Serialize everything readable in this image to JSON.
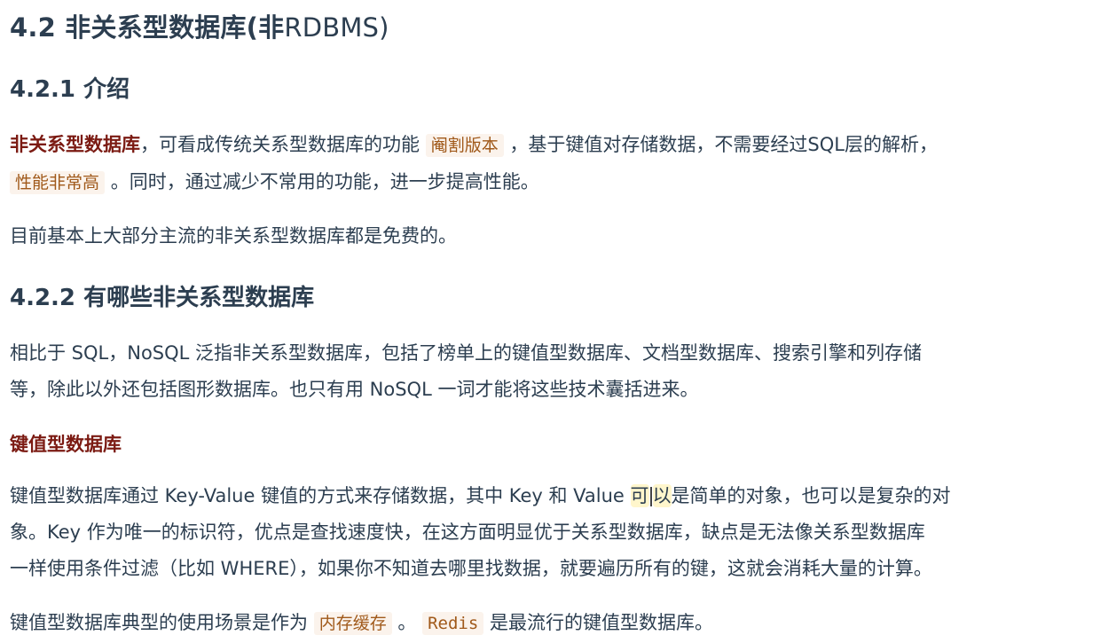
{
  "section": {
    "title_num": "4.2",
    "title_text": "非关系型数据库(非",
    "title_latin": "RDBMS)"
  },
  "intro": {
    "heading": "4.2.1 介绍",
    "p1": {
      "bold": "非关系型数据库",
      "t1": "，可看成传统关系型数据库的功能",
      "code1": "阉割版本",
      "t2": "，基于键值对存储数据，不需要经过SQL层的解析，",
      "code2": "性能非常高",
      "t3": "。同时，通过减少不常用的功能，进一步提高性能。"
    },
    "p2": "目前基本上大部分主流的非关系型数据库都是免费的。"
  },
  "types": {
    "heading": "4.2.2 有哪些非关系型数据库",
    "p1_line1": "相比于 SQL，NoSQL 泛指非关系型数据库，包括了榜单上的键值型数据库、文档型数据库、搜索引擎和列存储",
    "p1_line2": "等，除此以外还包括图形数据库。也只有用 NoSQL 一词才能将这些技术囊括进来。"
  },
  "kv": {
    "heading": "键值型数据库",
    "p1_line1_a": "键值型数据库通过 Key-Value 键值的方式来存储数据，其中 Key 和 Value ",
    "p1_line1_hl1": "可",
    "p1_line1_hl2": "以",
    "p1_line1_b": "是简单的对象，也可以是复杂的对",
    "p1_line2": "象。Key 作为唯一的标识符，优点是查找速度快，在这方面明显优于关系型数据库，缺点是无法像关系型数据库",
    "p1_line3": "一样使用条件过滤（比如 WHERE），如果你不知道去哪里找数据，就要遍历所有的键，这就会消耗大量的计算。",
    "p2": {
      "t1": "键值型数据库典型的使用场景是作为",
      "code1": "内存缓存",
      "t2": "。",
      "code2": "Redis",
      "t3": "是最流行的键值型数据库。"
    }
  }
}
